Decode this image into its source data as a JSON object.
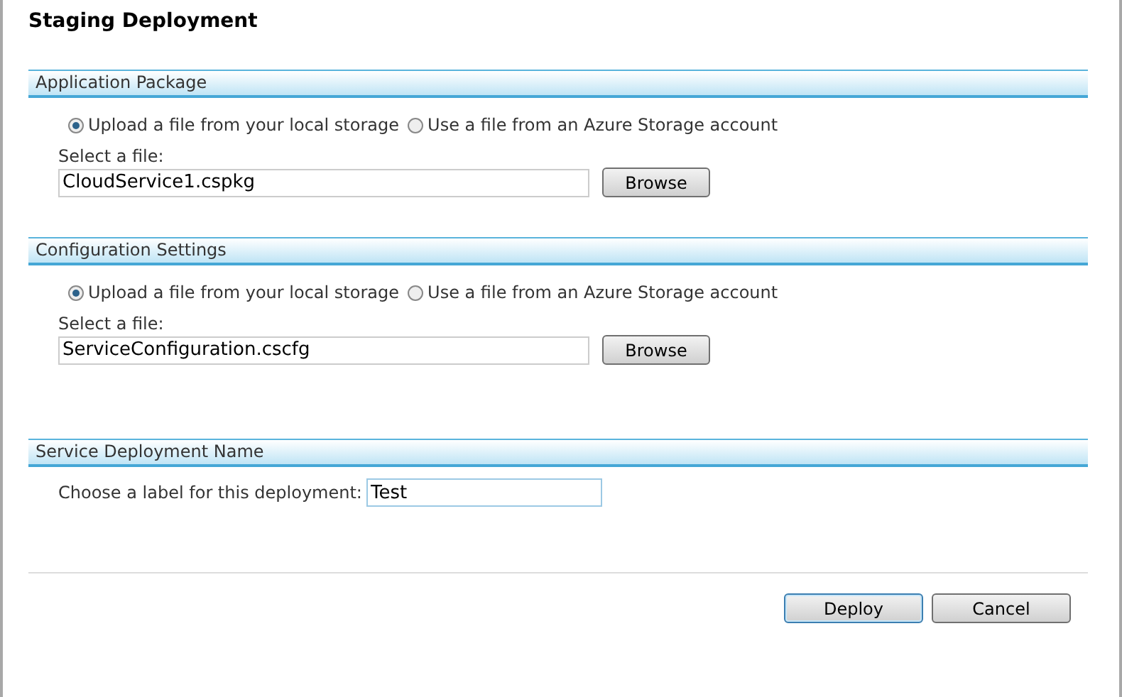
{
  "title": "Staging Deployment",
  "sections": [
    {
      "heading": "Application Package",
      "options": [
        {
          "label": "Upload a file from your local storage",
          "selected": true
        },
        {
          "label": "Use a file from an Azure Storage account",
          "selected": false
        }
      ],
      "file_label": "Select a file:",
      "file_value": "CloudService1.cspkg",
      "browse": "Browse"
    },
    {
      "heading": "Configuration Settings",
      "options": [
        {
          "label": "Upload a file from your local storage",
          "selected": true
        },
        {
          "label": "Use a file from an Azure Storage account",
          "selected": false
        }
      ],
      "file_label": "Select a file:",
      "file_value": "ServiceConfiguration.cscfg",
      "browse": "Browse"
    }
  ],
  "deployment_name": {
    "heading": "Service Deployment Name",
    "label": "Choose a label for this deployment:",
    "value": "Test"
  },
  "buttons": [
    {
      "label": "Deploy",
      "default": true
    },
    {
      "label": "Cancel",
      "default": false
    }
  ]
}
